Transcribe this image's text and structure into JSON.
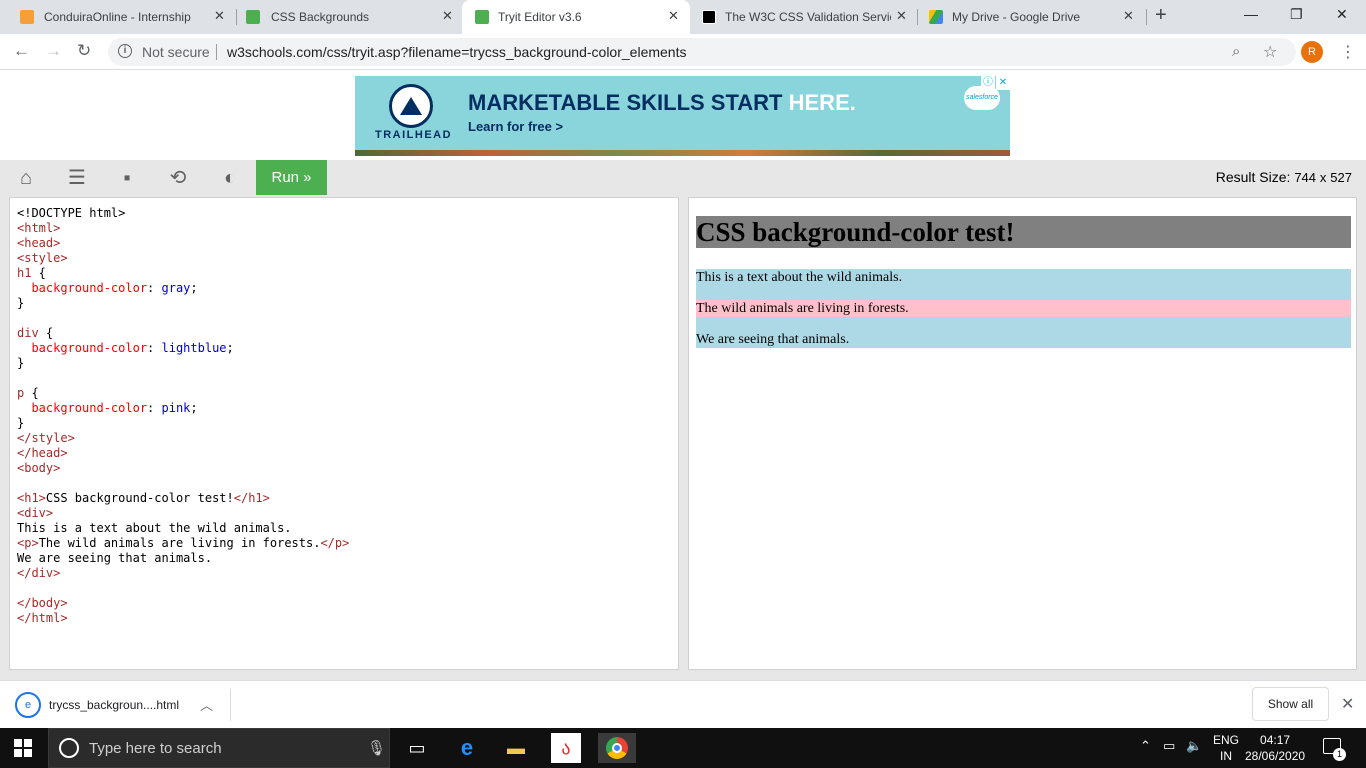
{
  "browser": {
    "tabs": [
      {
        "title": "ConduiraOnline - Internship",
        "favicon": "rocket-icon",
        "active": false
      },
      {
        "title": "CSS Backgrounds",
        "favicon": "w3schools-icon",
        "active": false
      },
      {
        "title": "Tryit Editor v3.6",
        "favicon": "w3schools-icon",
        "active": true
      },
      {
        "title": "The W3C CSS Validation Servic",
        "favicon": "w3c-icon",
        "active": false
      },
      {
        "title": "My Drive - Google Drive",
        "favicon": "google-drive-icon",
        "active": false
      }
    ],
    "new_tab_label": "+",
    "security_label": "Not secure",
    "url": "w3schools.com/css/tryit.asp?filename=trycss_background-color_elements",
    "profile_initial": "R"
  },
  "ad": {
    "brand": "TRAILHEAD",
    "headline_a": "MARKETABLE SKILLS START",
    "headline_b": "HERE.",
    "subline": "Learn for free >",
    "partner": "salesforce"
  },
  "tryit_toolbar": {
    "run_label": "Run »",
    "result_size_label": "Result Size:",
    "result_width": "744",
    "result_x": "x",
    "result_height": "527"
  },
  "code_lines": [
    "<!DOCTYPE html>",
    "<html>",
    "<head>",
    "<style>",
    "h1 {",
    "  background-color: gray;",
    "}",
    "",
    "div {",
    "  background-color: lightblue;",
    "}",
    "",
    "p {",
    "  background-color: pink;",
    "}",
    "</style>",
    "</head>",
    "<body>",
    "",
    "<h1>CSS background-color test!</h1>",
    "<div>",
    "This is a text about the wild animals.",
    "<p>The wild animals are living in forests.</p>",
    "We are seeing that animals.",
    "</div>",
    "",
    "</body>",
    "</html>"
  ],
  "result": {
    "heading": "CSS background-color test!",
    "div_line1": "This is a text about the wild animals.",
    "p_text": "The wild animals are living in forests.",
    "div_line3": "We are seeing that animals.",
    "colors": {
      "h1_bg": "gray",
      "div_bg": "lightblue",
      "p_bg": "pink"
    }
  },
  "download_shelf": {
    "file_name": "trycss_backgroun....html",
    "show_all_label": "Show all"
  },
  "taskbar": {
    "search_placeholder": "Type here to search",
    "lang_top": "ENG",
    "lang_bottom": "IN",
    "time": "04:17",
    "date": "28/06/2020",
    "notification_count": "1"
  }
}
